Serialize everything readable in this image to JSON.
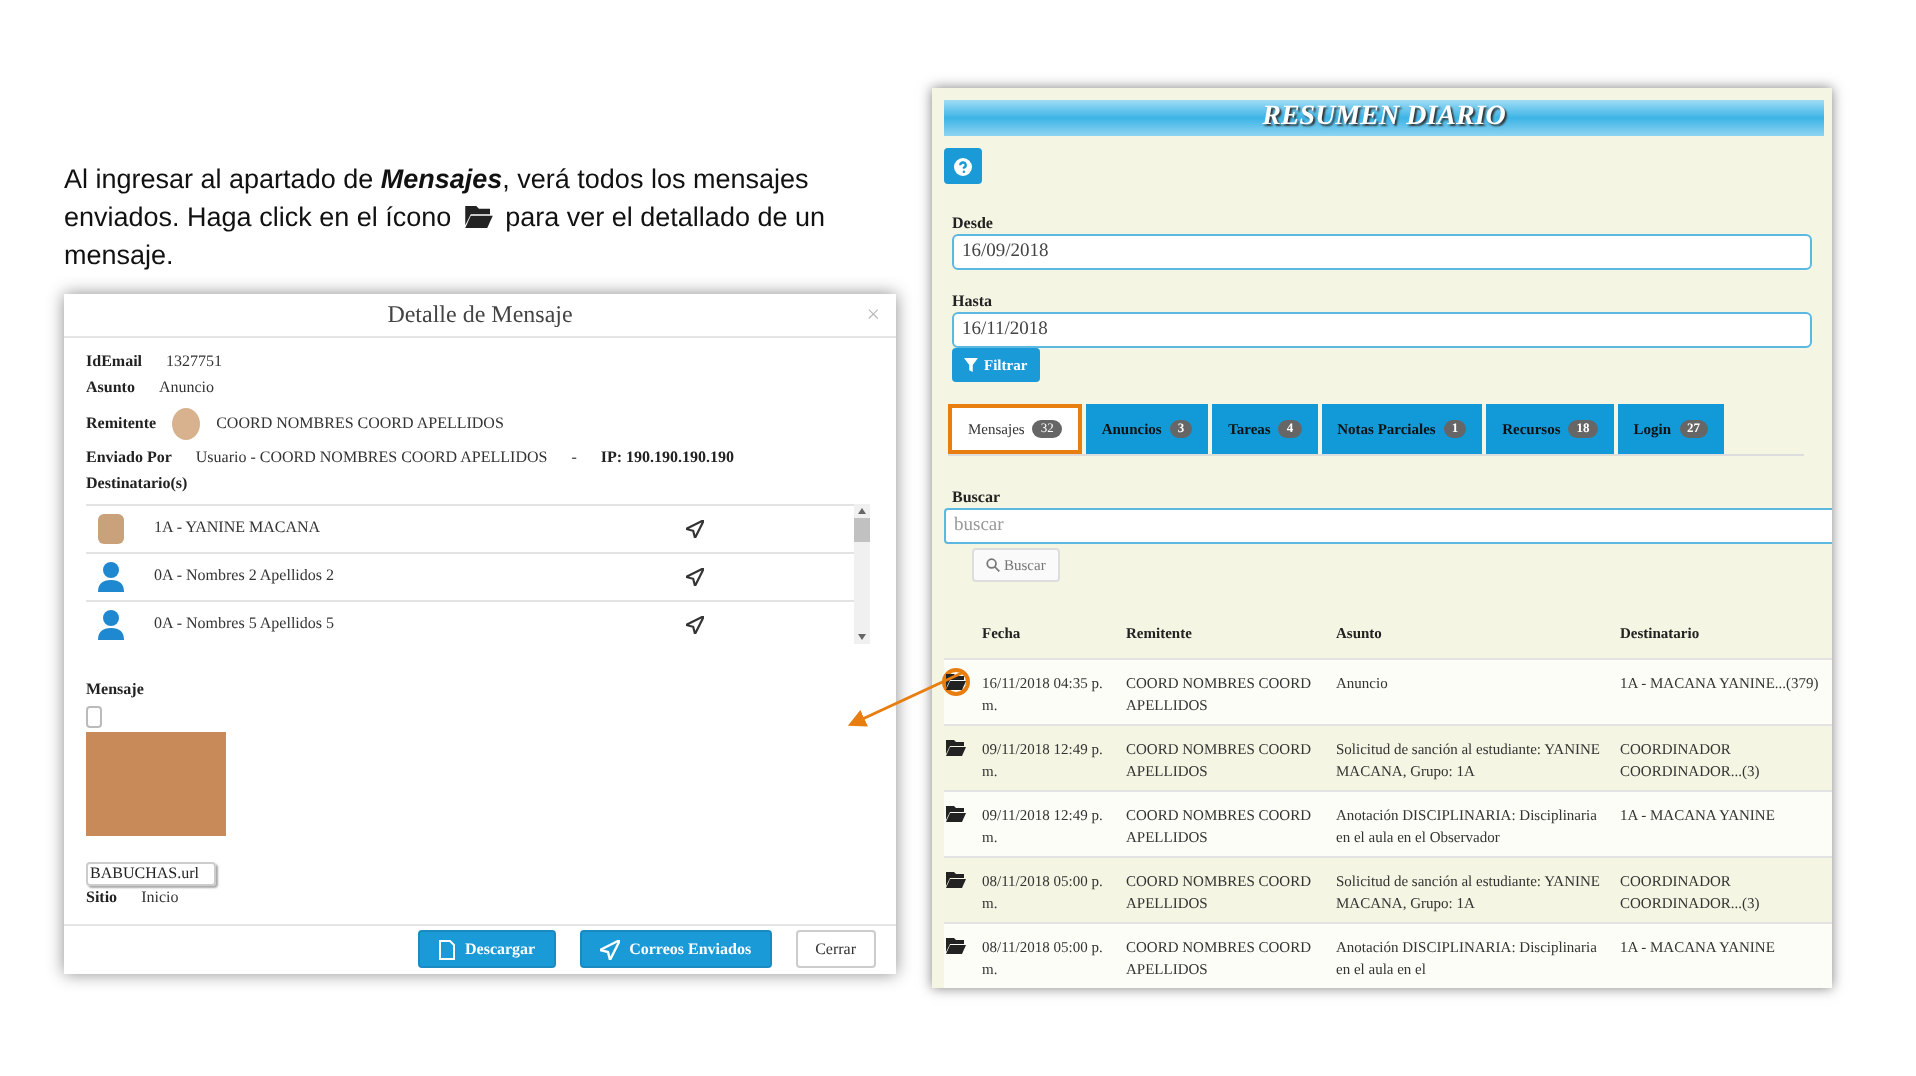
{
  "intro": {
    "line1": "Al ingresar al apartado de **Mensajes**, verá todos los mensajes",
    "line2_before_icon": "enviados. Haga click en el ícono",
    "line2_after_icon": "para ver el detallado de un",
    "line3": "mensaje."
  },
  "dialog": {
    "title": "Detalle de Mensaje",
    "close": "×",
    "fields": [
      {
        "label": "IdEmail",
        "value": "1327751"
      },
      {
        "label": "Asunto",
        "value": "Anuncio"
      }
    ],
    "sender": {
      "label": "Remitente",
      "value": "COORD NOMBRES COORD APELLIDOS"
    },
    "sent_by": {
      "label": "Enviado Por",
      "value": "Usuario - COORD NOMBRES COORD APELLIDOS",
      "separator": "-",
      "ip": "IP: 190.190.190.190"
    },
    "recipients_label": "Destinatario(s)",
    "recipients": [
      {
        "kind": "photo",
        "name": "1A - YANINE MACANA"
      },
      {
        "kind": "user",
        "name": "0A - Nombres 2 Apellidos 2"
      },
      {
        "kind": "user",
        "name": "0A - Nombres 5 Apellidos 5"
      }
    ],
    "message_label": "Mensaje",
    "message_checkbox": {
      "checked": false
    },
    "attachment": "BABUCHAS.url",
    "site": {
      "label": "Sitio",
      "value": "Inicio"
    },
    "buttons": [
      {
        "kind": "download",
        "label": "Descargar"
      },
      {
        "kind": "sent",
        "label": "Correos Enviados"
      },
      {
        "kind": "close",
        "label": "Cerrar"
      }
    ]
  },
  "panel": {
    "title": "RESUMEN DIARIO",
    "from": {
      "label": "Desde",
      "value": "16/09/2018"
    },
    "to": {
      "label": "Hasta",
      "value": "16/11/2018"
    },
    "filter_button": "Filtrar",
    "tabs": [
      {
        "label": "Mensajes",
        "count": "32",
        "selected": true
      },
      {
        "label": "Anuncios",
        "count": "3",
        "selected": false
      },
      {
        "label": "Tareas",
        "count": "4",
        "selected": false
      },
      {
        "label": "Notas Parciales",
        "count": "1",
        "selected": false
      },
      {
        "label": "Recursos",
        "count": "18",
        "selected": false
      },
      {
        "label": "Login",
        "count": "27",
        "selected": false
      }
    ],
    "search": {
      "label": "Buscar",
      "placeholder": "buscar",
      "button": "Buscar"
    },
    "table": {
      "columns": [
        "Fecha",
        "Remitente",
        "Asunto",
        "Destinatario"
      ],
      "rows": [
        {
          "marked": true,
          "cells": [
            "16/11/2018 04:35 p. m.",
            "COORD NOMBRES COORD APELLIDOS",
            "Anuncio",
            "1A - MACANA YANINE...(379)"
          ]
        },
        {
          "marked": false,
          "cells": [
            "09/11/2018 12:49 p. m.",
            "COORD NOMBRES COORD APELLIDOS",
            "Solicitud de sanción al estudiante: YANINE MACANA, Grupo: 1A",
            "COORDINADOR COORDINADOR...(3)"
          ]
        },
        {
          "marked": false,
          "cells": [
            "09/11/2018 12:49 p. m.",
            "COORD NOMBRES COORD APELLIDOS",
            "Anotación DISCIPLINARIA: Disciplinaria en el aula en el Observador",
            "1A - MACANA YANINE"
          ]
        },
        {
          "marked": false,
          "cells": [
            "08/11/2018 05:00 p. m.",
            "COORD NOMBRES COORD APELLIDOS",
            "Solicitud de sanción al estudiante: YANINE MACANA, Grupo: 1A",
            "COORDINADOR COORDINADOR...(3)"
          ]
        },
        {
          "marked": false,
          "cells": [
            "08/11/2018 05:00 p. m.",
            "COORD NOMBRES COORD APELLIDOS",
            "Anotación DISCIPLINARIA: Disciplinaria en el aula en el",
            "1A - MACANA YANINE"
          ]
        }
      ]
    }
  }
}
